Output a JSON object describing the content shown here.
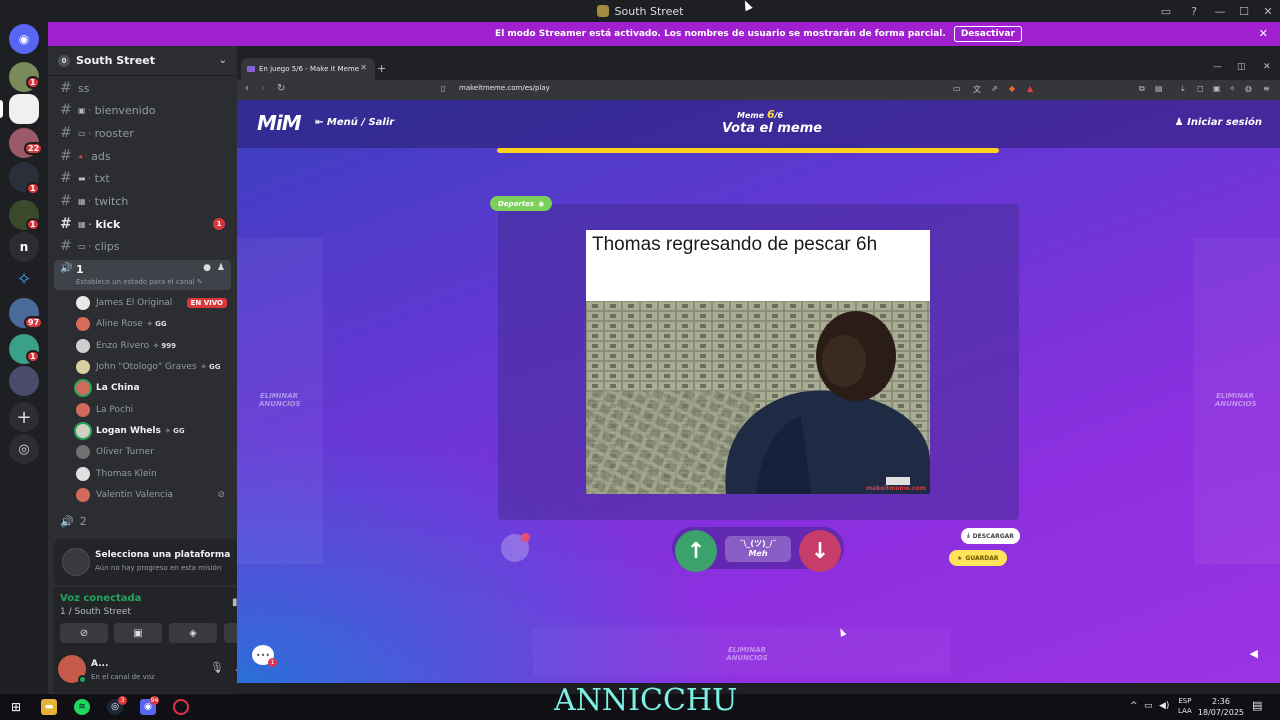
{
  "window": {
    "title": "South Street"
  },
  "banner": {
    "text": "El modo Streamer está activado. Los nombres de usuario se mostrarán de forma parcial.",
    "button": "Desactivar"
  },
  "rail": {
    "badges": [
      "1",
      "22",
      "1",
      "1",
      "97",
      "1"
    ],
    "letter": "n"
  },
  "server": {
    "name": "South Street"
  },
  "channels": [
    {
      "name": "ss",
      "emoji": "",
      "unread": false
    },
    {
      "name": "bienvenido",
      "emoji": "▣ ·",
      "unread": false
    },
    {
      "name": "rooster",
      "emoji": "▭ ·",
      "unread": false
    },
    {
      "name": "ads",
      "emoji": "◂ ·",
      "unread": false
    },
    {
      "name": "txt",
      "emoji": "▬ ·",
      "unread": false
    },
    {
      "name": "twitch",
      "emoji": "▦ ·",
      "unread": false
    },
    {
      "name": "kick",
      "emoji": "▦ ·",
      "unread": true,
      "badge": "1"
    },
    {
      "name": "clips",
      "emoji": "▭ ·",
      "unread": false
    }
  ],
  "voice_channel": {
    "name": "1",
    "status": "Establece un estado para el canal ✎"
  },
  "voice_users": [
    {
      "name": "James El Original",
      "tag": "",
      "live": "EN VIVO",
      "active": false,
      "avatar": "#e8e8e8"
    },
    {
      "name": "Aline Rose",
      "tag": "✧ GG",
      "active": false,
      "avatar": "#d86a5a"
    },
    {
      "name": "Enzo Rivero",
      "tag": "✧ 999",
      "active": false,
      "avatar": "#cfcfcf"
    },
    {
      "name": "John \"Otologo\" Graves",
      "tag": "✧ GG",
      "active": false,
      "avatar": "#d8d0a0"
    },
    {
      "name": "La China",
      "tag": "",
      "active": true,
      "avatar": "#d06a5a"
    },
    {
      "name": "La Pochi",
      "tag": "",
      "active": false,
      "avatar": "#d06a5a"
    },
    {
      "name": "Logan Whels",
      "tag": "✧ GG",
      "active": true,
      "avatar": "#cfd0c0"
    },
    {
      "name": "Oliver Turner",
      "tag": "",
      "active": false,
      "avatar": "#707070"
    },
    {
      "name": "Thomas Klein",
      "tag": "",
      "active": false,
      "avatar": "#e0e0e0"
    },
    {
      "name": "Valentin Valencia",
      "tag": "",
      "active": false,
      "muted": true,
      "avatar": "#d06a5a"
    }
  ],
  "voice_channel_2": {
    "name": "2"
  },
  "platform": {
    "title": "Selecciona una plataforma",
    "subtitle": "Aún no hay progreso en esta misión"
  },
  "voice_connection": {
    "status": "Voz conectada",
    "location": "1 / South Street"
  },
  "user": {
    "name": "A...",
    "status": "En el canal de voz"
  },
  "browser": {
    "tab_title": "En juego 5/6 - Make it Meme",
    "url": "makeitmeme.com/es/play"
  },
  "game": {
    "logo": "MiM",
    "menu": "Menú / Salir",
    "meme_label": "Meme",
    "meme_current": "6",
    "meme_total": "/6",
    "heading": "Vota el meme",
    "login": "Iniciar sesión",
    "timer_progress": 1.0,
    "category_tag": "Deportes",
    "ad_text": "ELIMINAR ANUNCIOS",
    "meme_caption": "Thomas regresando de pescar 6h",
    "meme_watermark": "makeitmeme.com",
    "meh_face": "¯\\_(ツ)_/¯",
    "meh_label": "Meh",
    "download": "DESCARGAR",
    "favorite": "GUARDAR",
    "bottom_ad": "ELIMINAR ANUNCIOS"
  },
  "taskbar": {
    "watermark": "ANNICCHU",
    "lang_1": "ESP",
    "lang_2": "LAA",
    "time": "2:36",
    "date": "18/07/2025",
    "badge_discord": "94",
    "badge_steam": "3"
  }
}
